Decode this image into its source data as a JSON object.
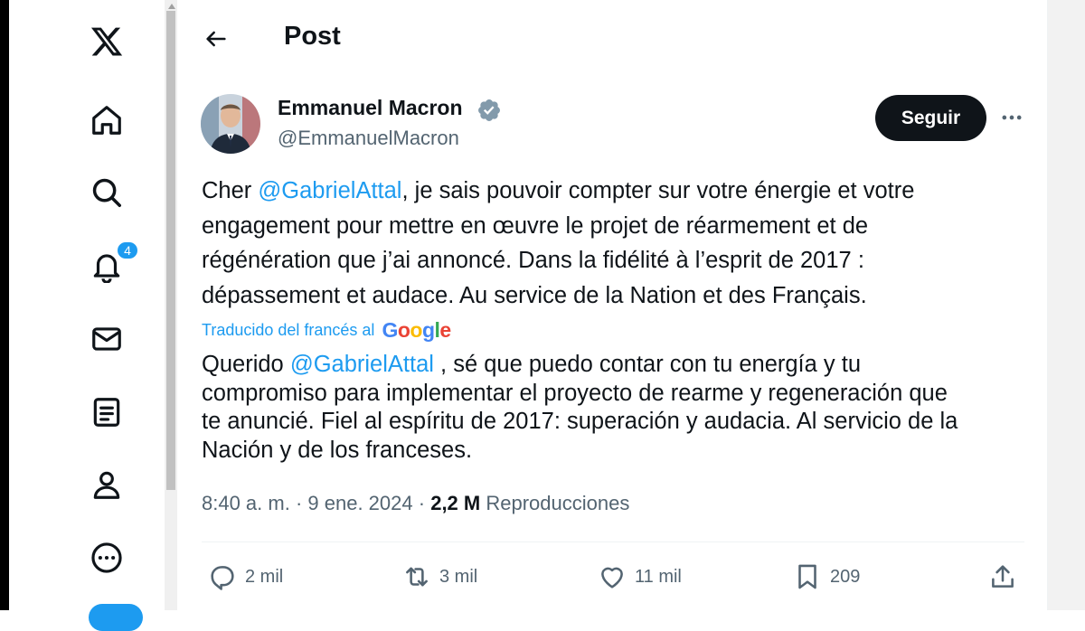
{
  "header": {
    "title": "Post"
  },
  "sidebar": {
    "notification_count": "4",
    "items": [
      {
        "name": "x-logo-icon"
      },
      {
        "name": "home-icon"
      },
      {
        "name": "search-icon"
      },
      {
        "name": "bell-icon"
      },
      {
        "name": "mail-icon"
      },
      {
        "name": "list-icon"
      },
      {
        "name": "profile-icon"
      },
      {
        "name": "more-circle-icon"
      }
    ]
  },
  "author": {
    "name": "Emmanuel Macron",
    "handle": "@EmmanuelMacron",
    "verified": true,
    "follow_label": "Seguir"
  },
  "tweet": {
    "line1_prefix": "Cher ",
    "mention": "@GabrielAttal",
    "line1_suffix": ", je sais pouvoir compter sur votre énergie et votre",
    "line2": "engagement pour mettre en œuvre le projet de réarmement et de",
    "line3": "régénération que j’ai annoncé. Dans la fidélité à l’esprit de 2017 :",
    "line4": "dépassement et audace. Au service de la Nation et des Français."
  },
  "translation": {
    "label": "Traducido del francés al",
    "provider": "Google",
    "prefix": "Querido ",
    "mention": "@GabrielAttal",
    "line1_suffix": " , sé que puedo contar con tu energía y tu",
    "line2": "compromiso para implementar el proyecto de rearme y regeneración que",
    "line3": "te anuncié. Fiel al espíritu de 2017: superación y audacia. Al servicio de la",
    "line4": "Nación y de los franceses."
  },
  "meta": {
    "time": "8:40 a. m.",
    "separator": " · ",
    "date": "9 ene. 2024",
    "views_count": "2,2 M",
    "views_label": " Reproducciones"
  },
  "actions": {
    "replies": "2 mil",
    "reposts": "3 mil",
    "likes": "11 mil",
    "bookmarks": "209"
  },
  "colors": {
    "accent": "#1d9bf0",
    "text": "#0f1419",
    "muted": "#536471"
  }
}
